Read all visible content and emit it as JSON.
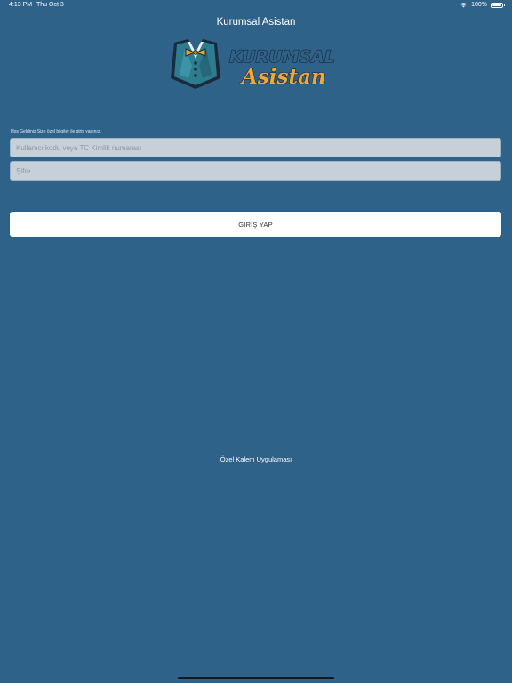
{
  "status_bar": {
    "time": "4:13 PM",
    "date": "Thu Oct 3",
    "battery": "100%"
  },
  "header": {
    "title": "Kurumsal Asistan"
  },
  "logo": {
    "line1": "KURUMSAL",
    "line2": "Asistan",
    "colors": {
      "vest": "#2e7c8f",
      "bowtie": "#f0a432",
      "text_outline": "#1b2a3a",
      "text_fill_dark": "#2e6289",
      "text_fill_orange": "#f3a73a"
    }
  },
  "login": {
    "welcome_text": "Hoş Geldiniz Size özel bilgiler ile giriş yapınız.",
    "username_placeholder": "Kullanıcı kodu veya TC Kimlik numarası",
    "username_value": "",
    "password_placeholder": "Şifre",
    "password_value": "",
    "submit_label": "GİRİŞ YAP"
  },
  "footer": {
    "text": "Özel Kalem Uygulaması"
  },
  "colors": {
    "background": "#2e6289",
    "button_bg": "#ffffff",
    "field_bg": "#c7d0d9"
  }
}
